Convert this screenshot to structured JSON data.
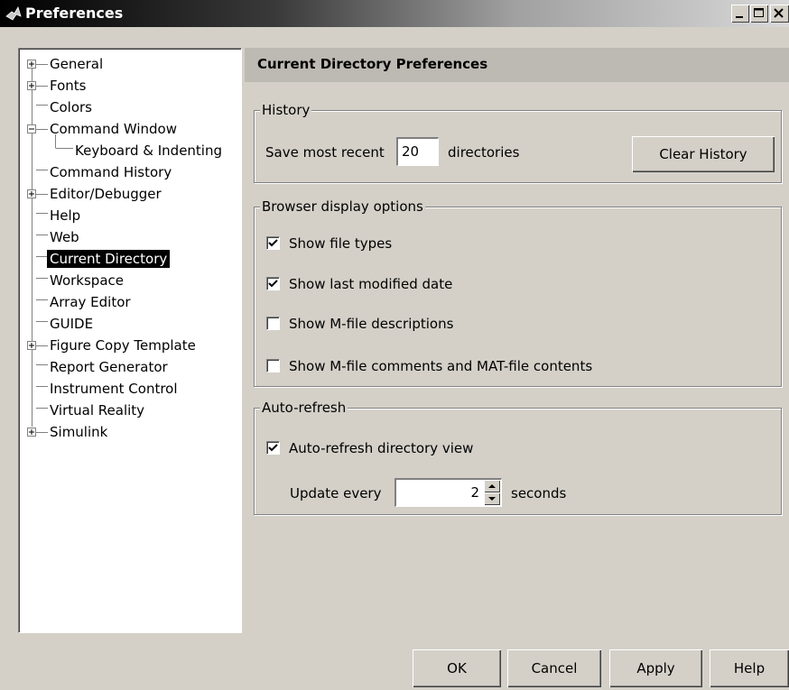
{
  "window": {
    "title": "Preferences"
  },
  "tree": {
    "items": [
      {
        "label": "General",
        "expander": "plus"
      },
      {
        "label": "Fonts",
        "expander": "plus"
      },
      {
        "label": "Colors",
        "expander": "none"
      },
      {
        "label": "Command Window",
        "expander": "minus"
      },
      {
        "label": "Keyboard & Indenting",
        "expander": "child"
      },
      {
        "label": "Command History",
        "expander": "none"
      },
      {
        "label": "Editor/Debugger",
        "expander": "plus"
      },
      {
        "label": "Help",
        "expander": "none"
      },
      {
        "label": "Web",
        "expander": "none"
      },
      {
        "label": "Current Directory",
        "expander": "none",
        "selected": true
      },
      {
        "label": "Workspace",
        "expander": "none"
      },
      {
        "label": "Array Editor",
        "expander": "none"
      },
      {
        "label": "GUIDE",
        "expander": "none"
      },
      {
        "label": "Figure Copy Template",
        "expander": "plus"
      },
      {
        "label": "Report Generator",
        "expander": "none"
      },
      {
        "label": "Instrument Control",
        "expander": "none"
      },
      {
        "label": "Virtual Reality",
        "expander": "none"
      },
      {
        "label": "Simulink",
        "expander": "plus"
      }
    ]
  },
  "panel": {
    "title": "Current Directory Preferences",
    "history": {
      "legend": "History",
      "save_label": "Save most recent",
      "save_value": "20",
      "directories_label": "directories",
      "clear_button": "Clear History"
    },
    "browser": {
      "legend": "Browser display options",
      "options": [
        {
          "label": "Show file types",
          "checked": true
        },
        {
          "label": "Show last modified date",
          "checked": true
        },
        {
          "label": "Show M-file descriptions",
          "checked": false
        },
        {
          "label": "Show M-file comments and MAT-file contents",
          "checked": false
        }
      ]
    },
    "autorefresh": {
      "legend": "Auto-refresh",
      "checkbox_label": "Auto-refresh directory view",
      "checked": true,
      "update_label": "Update every",
      "update_value": "2",
      "seconds_label": "seconds"
    }
  },
  "buttons": {
    "ok": "OK",
    "cancel": "Cancel",
    "apply": "Apply",
    "help": "Help"
  }
}
